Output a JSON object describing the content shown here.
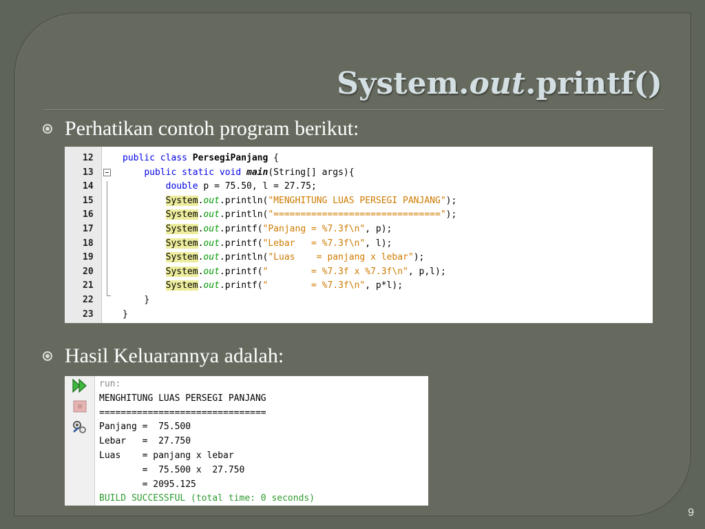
{
  "slide": {
    "title_part1": "System.",
    "title_part2": "out",
    "title_part3": ".printf()",
    "bullet1": "Perhatikan contoh program berikut:",
    "bullet2": "Hasil Keluarannya adalah:",
    "page_number": "9"
  },
  "code_editor": {
    "lines": [
      {
        "num": "12",
        "indent": "",
        "parts": [
          [
            "kw",
            "public class "
          ],
          [
            "bold",
            "PersegiPanjang"
          ],
          [
            "plain",
            " {"
          ]
        ]
      },
      {
        "num": "13",
        "indent": "    ",
        "parts": [
          [
            "kw",
            "public static void "
          ],
          [
            "bi",
            "main"
          ],
          [
            "plain",
            "(String[] args){"
          ]
        ]
      },
      {
        "num": "14",
        "indent": "        ",
        "parts": [
          [
            "kw",
            "double"
          ],
          [
            "plain",
            " p = 75.50, l = 27.75;"
          ]
        ]
      },
      {
        "num": "15",
        "indent": "        ",
        "parts": [
          [
            "sys",
            "System"
          ],
          [
            "plain",
            "."
          ],
          [
            "out",
            "out"
          ],
          [
            "plain",
            ".println("
          ],
          [
            "str",
            "\"MENGHITUNG LUAS PERSEGI PANJANG\""
          ],
          [
            "plain",
            ");"
          ]
        ]
      },
      {
        "num": "16",
        "indent": "        ",
        "parts": [
          [
            "sys",
            "System"
          ],
          [
            "plain",
            "."
          ],
          [
            "out",
            "out"
          ],
          [
            "plain",
            ".println("
          ],
          [
            "str",
            "\"===============================\""
          ],
          [
            "plain",
            ");"
          ]
        ]
      },
      {
        "num": "17",
        "indent": "        ",
        "parts": [
          [
            "sys",
            "System"
          ],
          [
            "plain",
            "."
          ],
          [
            "out",
            "out"
          ],
          [
            "plain",
            ".printf("
          ],
          [
            "str",
            "\"Panjang = %7.3f\\n\""
          ],
          [
            "plain",
            ", p);"
          ]
        ]
      },
      {
        "num": "18",
        "indent": "        ",
        "parts": [
          [
            "sys",
            "System"
          ],
          [
            "plain",
            "."
          ],
          [
            "out",
            "out"
          ],
          [
            "plain",
            ".printf("
          ],
          [
            "str",
            "\"Lebar   = %7.3f\\n\""
          ],
          [
            "plain",
            ", l);"
          ]
        ]
      },
      {
        "num": "19",
        "indent": "        ",
        "parts": [
          [
            "sys",
            "System"
          ],
          [
            "plain",
            "."
          ],
          [
            "out",
            "out"
          ],
          [
            "plain",
            ".println("
          ],
          [
            "str",
            "\"Luas    = panjang x lebar\""
          ],
          [
            "plain",
            ");"
          ]
        ]
      },
      {
        "num": "20",
        "indent": "        ",
        "parts": [
          [
            "sys",
            "System"
          ],
          [
            "plain",
            "."
          ],
          [
            "out",
            "out"
          ],
          [
            "plain",
            ".printf("
          ],
          [
            "str",
            "\"        = %7.3f x %7.3f\\n\""
          ],
          [
            "plain",
            ", p,l);"
          ]
        ]
      },
      {
        "num": "21",
        "indent": "        ",
        "parts": [
          [
            "sys",
            "System"
          ],
          [
            "plain",
            "."
          ],
          [
            "out",
            "out"
          ],
          [
            "plain",
            ".printf("
          ],
          [
            "str",
            "\"        = %7.3f\\n\""
          ],
          [
            "plain",
            ", p*l);"
          ]
        ]
      },
      {
        "num": "22",
        "indent": "    ",
        "parts": [
          [
            "plain",
            "}"
          ]
        ]
      },
      {
        "num": "23",
        "indent": "",
        "parts": [
          [
            "plain",
            "}"
          ]
        ]
      }
    ]
  },
  "output_window": {
    "icons": [
      "run-again-icon",
      "stop-icon",
      "settings-icon"
    ],
    "lines": [
      {
        "style": "gray",
        "text": "run:"
      },
      {
        "style": "plain",
        "text": "MENGHITUNG LUAS PERSEGI PANJANG"
      },
      {
        "style": "plain",
        "text": "==============================="
      },
      {
        "style": "plain",
        "text": "Panjang =  75.500"
      },
      {
        "style": "plain",
        "text": "Lebar   =  27.750"
      },
      {
        "style": "plain",
        "text": "Luas    = panjang x lebar"
      },
      {
        "style": "plain",
        "text": "        =  75.500 x  27.750"
      },
      {
        "style": "plain",
        "text": "        = 2095.125"
      },
      {
        "style": "green",
        "text": "BUILD SUCCESSFUL (total time: 0 seconds)"
      }
    ]
  }
}
